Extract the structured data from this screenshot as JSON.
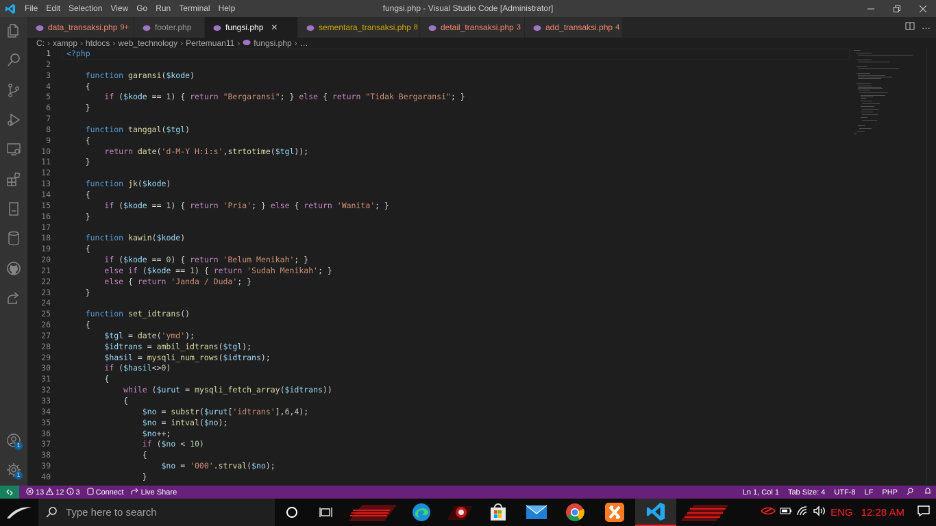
{
  "titlebar": {
    "menu": [
      "File",
      "Edit",
      "Selection",
      "View",
      "Go",
      "Run",
      "Terminal",
      "Help"
    ],
    "title": "fungsi.php - Visual Studio Code [Administrator]"
  },
  "tabs": [
    {
      "name": "data_transaksi.php",
      "count": "9+",
      "state": "err"
    },
    {
      "name": "footer.php",
      "count": "",
      "state": "plain"
    },
    {
      "name": "fungsi.php",
      "count": "",
      "state": "active"
    },
    {
      "name": "sementara_transaksi.php",
      "count": "8",
      "state": "warn"
    },
    {
      "name": "detail_transaksi.php",
      "count": "3",
      "state": "err"
    },
    {
      "name": "add_transaksi.php",
      "count": "4",
      "state": "err"
    }
  ],
  "breadcrumb": [
    "C:",
    "xampp",
    "htdocs",
    "web_technology",
    "Pertemuan11",
    "fungsi.php",
    "…"
  ],
  "editor": {
    "line_numbers": [
      "1",
      "2",
      "3",
      "4",
      "5",
      "6",
      "7",
      "8",
      "9",
      "10",
      "11",
      "12",
      "13",
      "14",
      "15",
      "16",
      "17",
      "18",
      "19",
      "20",
      "21",
      "22",
      "23",
      "24",
      "25",
      "26",
      "27",
      "28",
      "29",
      "30",
      "31",
      "32",
      "33",
      "34",
      "35",
      "36",
      "37",
      "38",
      "39",
      "40"
    ],
    "lines": [
      "<?php",
      "",
      "    function garansi($kode)",
      "    {",
      "        if ($kode == 1) { return \"Bergaransi\"; } else { return \"Tidak Bergaransi\"; }",
      "    }",
      "",
      "    function tanggal($tgl)",
      "    {",
      "        return date('d-M-Y H:i:s',strtotime($tgl));",
      "    }",
      "",
      "    function jk($kode)",
      "    {",
      "        if ($kode == 1) { return 'Pria'; } else { return 'Wanita'; }",
      "    }",
      "",
      "    function kawin($kode)",
      "    {",
      "        if ($kode == 0) { return 'Belum Menikah'; }",
      "        else if ($kode == 1) { return 'Sudah Menikah'; }",
      "        else { return 'Janda / Duda'; }",
      "    }",
      "",
      "    function set_idtrans()",
      "    {",
      "        $tgl = date('ymd');",
      "        $idtrans = ambil_idtrans($tgl);",
      "        $hasil = mysqli_num_rows($idtrans);",
      "        if ($hasil<>0)",
      "        {",
      "            while ($urut = mysqli_fetch_array($idtrans))",
      "            {",
      "                $no = substr($urut['idtrans'],6,4);",
      "                $no = intval($no);",
      "                $no++;",
      "                if ($no < 10)",
      "                {",
      "                    $no = '000'.strval($no);",
      "                }"
    ]
  },
  "statusbar": {
    "errors": "13",
    "warnings": "12",
    "info": "3",
    "connect": "Connect",
    "live_share": "Live Share",
    "position": "Ln 1, Col 1",
    "tab_size": "Tab Size: 4",
    "encoding": "UTF-8",
    "eol": "LF",
    "language": "PHP"
  },
  "activity_badges": {
    "accounts": "1",
    "settings": "1"
  },
  "taskbar": {
    "search_placeholder": "Type here to search",
    "language": "ENG",
    "time": "12:28 AM"
  },
  "colors": {
    "statusbar": "#68217a",
    "remote": "#16825d",
    "accent_red": "#ff2020"
  }
}
